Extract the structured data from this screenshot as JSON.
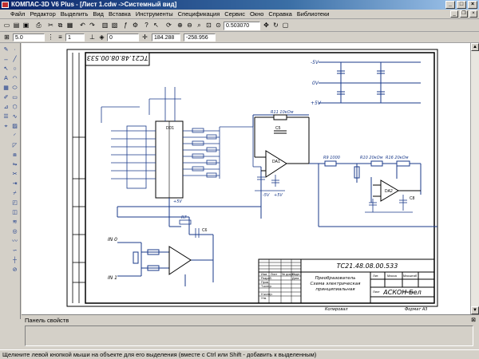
{
  "window": {
    "title": "КОМПАС-3D V6 Plus - [Лист 1.cdw ->Системный вид]"
  },
  "menu": [
    "Файл",
    "Редактор",
    "Выделить",
    "Вид",
    "Вставка",
    "Инструменты",
    "Спецификация",
    "Сервис",
    "Окно",
    "Справка",
    "Библиотеки"
  ],
  "toolbar": {
    "zoom": "0.503070",
    "coord_x": "184.288",
    "coord_y": "-258.956",
    "step": "5.0",
    "layer": "1",
    "style_num": "0"
  },
  "properties_panel": {
    "title": "Панель свойств"
  },
  "status": {
    "text": "Щелкните левой кнопкой мыши на объекте для его выделения (вместе с Ctrl или Shift - добавить к выделенным)"
  },
  "drawing": {
    "code_vertical": "ТС21.48.08.00.533",
    "code_title": "ТС21.48.08.00.533",
    "name_line1": "Преобразователь",
    "name_line2": "Схема электрическая",
    "name_line3": "принципиальная",
    "org": "АСКОН-Бел",
    "format": "Формат   А3",
    "copied": "Копировал",
    "labels": {
      "minus5v": "-5V",
      "plus5v": "+5V",
      "zero_v": "0V",
      "plus5v_top": "+5V",
      "in0": "IN 0",
      "in1": "IN 1",
      "dd": "DD1",
      "r11": "R11 10кОм",
      "r10": "R10 20кОм",
      "r9": "R9 1000",
      "r16": "R16 20кОм",
      "c5": "C5",
      "c8": "C8",
      "da1": "DA1",
      "da2": "DA2",
      "r7": "R7",
      "c6": "C6",
      "p_gnd_l": "-5V",
      "p_gnd_r": "+5V"
    },
    "title_rows": [
      "Изм.",
      "Лист",
      "№ докум.",
      "Подп.",
      "Дата"
    ],
    "title_left": [
      "Разраб.",
      "Пров.",
      "Т.контр.",
      "Н.контр.",
      "Утв."
    ],
    "title_right": [
      "Лит.",
      "Масса",
      "Масштаб",
      "Лист",
      "Листов"
    ]
  }
}
